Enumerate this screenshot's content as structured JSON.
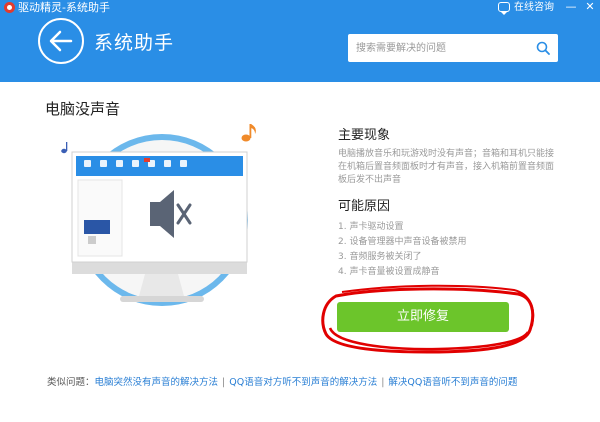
{
  "window": {
    "app_title": "驱动精灵-系统助手",
    "online_consult": "在线咨询",
    "header_color": "#2a8ee6"
  },
  "header": {
    "title": "系统助手",
    "search_placeholder": "搜索需要解决的问题"
  },
  "problem": {
    "title": "电脑没声音",
    "symptoms_heading": "主要现象",
    "symptoms_text": "电脑播放音乐和玩游戏时没有声音；音箱和耳机只能接在机箱后置音频面板时才有声音，接入机箱前置音频面板后发不出声音",
    "causes_heading": "可能原因",
    "causes": [
      "1. 声卡驱动设置",
      "2. 设备管理器中声音设备被禁用",
      "3. 音频服务被关闭了",
      "4. 声卡音量被设置成静音"
    ],
    "repair_button": "立即修复",
    "repair_color": "#6cc52b"
  },
  "related": {
    "label": "类似问题：",
    "links": [
      "电脑突然没有声音的解决方法",
      "QQ语音对方听不到声音的解决方法",
      "解决QQ语音听不到声音的问题"
    ]
  },
  "icons": [
    "app-logo",
    "chat-icon",
    "minimize-icon",
    "close-icon",
    "back-arrow-icon",
    "search-icon",
    "music-note-icon",
    "speaker-muted-icon"
  ]
}
